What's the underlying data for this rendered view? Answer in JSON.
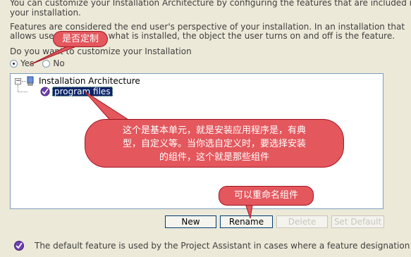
{
  "texts": {
    "intro_line1": "You can customize your Installation Architecture by configuring the features that are included in",
    "intro_line2": "your installation.",
    "features_line1": "Features are considered the end user's perspective of your installation. In an installation that",
    "features_line2": "allows users to choose what is installed, the object the user turns on and off is the feature.",
    "question": "Do you want to customize your Installation"
  },
  "radio": {
    "yes_label": "Yes",
    "no_label": "No",
    "selected": "Yes"
  },
  "tree": {
    "root_label": "Installation Architecture",
    "expander": "−",
    "child_label": "program files"
  },
  "buttons": {
    "new": "New",
    "rename": "Rename",
    "delete": "Delete",
    "set_default": "Set Default"
  },
  "footnote": "The default feature is used by the Project Assistant in cases where a feature designation",
  "annotations": {
    "bubble1": "是否定制",
    "bubble2_line1": "这个是基本单元，就是安装应用程序是，有典",
    "bubble2_line2": "型，自定义等。当你选自定义时，要选择安装",
    "bubble2_line3": "的组件，这个就是那些组件",
    "bubble3": "可以重命名组件"
  },
  "colors": {
    "background": "#ece9d8",
    "selection": "#0a246a",
    "bubble": "#e3575d",
    "button_border": "#003c74"
  }
}
